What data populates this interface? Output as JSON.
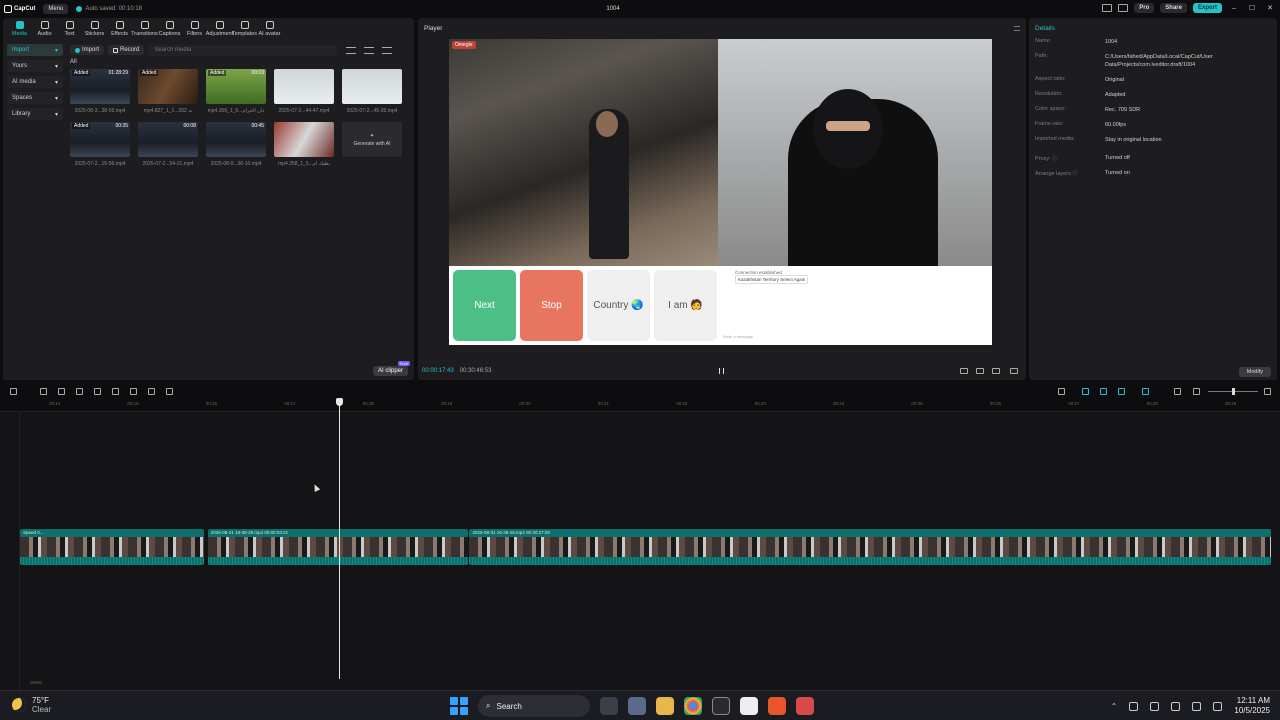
{
  "titlebar": {
    "app_name": "CapCut",
    "menu_label": "Menu",
    "autosave": "Auto saved: 00:10:18",
    "project_title": "1004",
    "pro_label": "Pro",
    "share_label": "Share",
    "export_label": "Export"
  },
  "tools": [
    "Media",
    "Audio",
    "Text",
    "Stickers",
    "Effects",
    "Transitions",
    "Captions",
    "Filters",
    "Adjustment",
    "Templates",
    "AI avatar"
  ],
  "sidebar": {
    "items": [
      {
        "label": "Import",
        "active": true
      },
      {
        "label": "Yours"
      },
      {
        "label": "AI media"
      },
      {
        "label": "Spaces"
      },
      {
        "label": "Library"
      }
    ]
  },
  "media": {
    "import_label": "Import",
    "record_label": "Record",
    "search_placeholder": "Search media",
    "filter_label": "All",
    "items": [
      {
        "name": "2025-08-3...38-59.mp4",
        "duration": "01:28:29",
        "added": "Added",
        "style": "t-dark"
      },
      {
        "name": "mp4.827_1_1...202 نه",
        "duration": "",
        "added": "Added",
        "style": "t-warm"
      },
      {
        "name": "mp4.359_1_5...دان الحرام",
        "duration": "00:03",
        "added": "Added",
        "style": "t-field"
      },
      {
        "name": "2025-07-2...44-47.mp4",
        "duration": "",
        "added": "",
        "style": "t-white"
      },
      {
        "name": "2025-07-2...45-39.mp4",
        "duration": "",
        "added": "",
        "style": "t-white"
      },
      {
        "name": "2025-07-2...15-56.mp4",
        "duration": "00:35",
        "added": "Added",
        "style": "t-dark"
      },
      {
        "name": "2025-07-2...54-21.mp4",
        "duration": "00:08",
        "added": "",
        "style": "t-dark"
      },
      {
        "name": "2025-08-0...36-10.mp4",
        "duration": "00:45",
        "added": "",
        "style": "t-dark"
      },
      {
        "name": "mp4.258_1_5...يطيك ام",
        "duration": "",
        "added": "",
        "style": "t-red"
      }
    ],
    "generate_label": "Generate with AI",
    "ai_clipper": "AI clipper",
    "ai_clipper_badge": "Free"
  },
  "player": {
    "title": "Player",
    "watermark": "Omegle",
    "buttons": {
      "next": "Next",
      "stop": "Stop",
      "country": "Country 🌏",
      "iam": "I am 🧑"
    },
    "chat_line1": "Connection established",
    "chat_line2": "Kazakhstan Territory Select Again",
    "chat_input": "Write a message",
    "current_time": "00:00:17:43",
    "total_time": "00:30:46:53"
  },
  "details": {
    "title": "Details",
    "rows": [
      {
        "key": "Name:",
        "value": "1004"
      },
      {
        "key": "Path:",
        "value": "C:/Users/fahed/AppData/Local/CapCut/User Data/Projects/com.lveditor.draft/1004"
      },
      {
        "key": "Aspect ratio:",
        "value": "Original"
      },
      {
        "key": "Resolution:",
        "value": "Adapted"
      },
      {
        "key": "Color space:",
        "value": "Rec. 709 SDR"
      },
      {
        "key": "Frame rate:",
        "value": "60.00fps"
      },
      {
        "key": "Imported media:",
        "value": "Stay in original location"
      },
      {
        "key": "Proxy: ⓘ",
        "value": "Turned off"
      },
      {
        "key": "Arrange layers ⓘ",
        "value": "Turned on"
      }
    ],
    "modify_label": "Modify"
  },
  "timeline": {
    "ruler": [
      "00:14",
      "00:15",
      "00:16",
      "00:17",
      "00:18",
      "00:19",
      "00:20",
      "00:21",
      "00:22",
      "00:23",
      "00:24",
      "00:25",
      "00:26",
      "00:27",
      "00:28",
      "00:29"
    ],
    "clips": [
      {
        "label": "Speed 0...",
        "start_pct": 0,
        "width_pct": 14.8
      },
      {
        "label": "2025-08-31 19-38-29.mp4   00:00:03:21",
        "start_pct": 15,
        "width_pct": 20.9
      },
      {
        "label": "2025-08-31 19-38-29.mp4   00:30:27:28",
        "start_pct": 35.9,
        "width_pct": 64.1
      }
    ]
  },
  "taskbar": {
    "temp": "75°F",
    "condition": "Clear",
    "search_label": "Search",
    "time": "12:11 AM",
    "date": "10/5/2025"
  }
}
